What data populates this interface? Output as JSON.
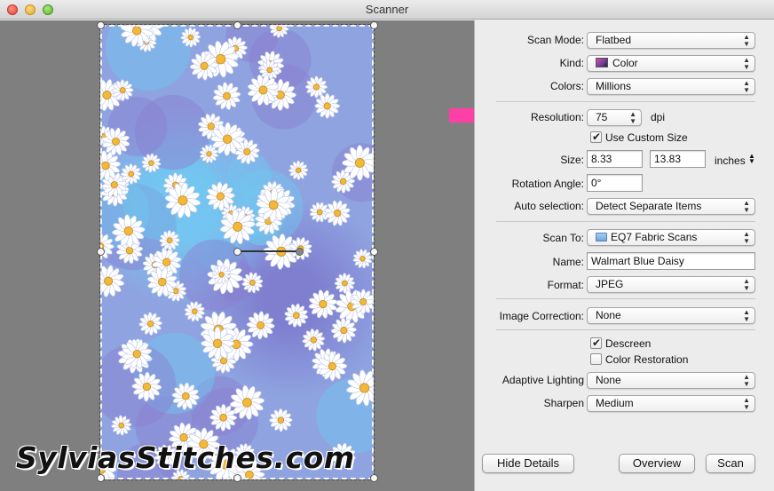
{
  "window": {
    "title": "Scanner"
  },
  "watermark": "SylviasStitches.com",
  "settings": {
    "scan_mode": {
      "label": "Scan Mode:",
      "value": "Flatbed"
    },
    "kind": {
      "label": "Kind:",
      "value": "Color"
    },
    "colors": {
      "label": "Colors:",
      "value": "Millions"
    },
    "resolution": {
      "label": "Resolution:",
      "value": "75",
      "unit": "dpi"
    },
    "use_custom_size": {
      "label": "Use Custom Size",
      "checked": true
    },
    "size": {
      "label": "Size:",
      "width": "8.33",
      "height": "13.83",
      "unit": "inches"
    },
    "rotation_angle": {
      "label": "Rotation Angle:",
      "value": "0°"
    },
    "auto_selection": {
      "label": "Auto selection:",
      "value": "Detect Separate Items"
    },
    "scan_to": {
      "label": "Scan To:",
      "value": "EQ7 Fabric Scans"
    },
    "name": {
      "label": "Name:",
      "value": "Walmart Blue Daisy"
    },
    "format": {
      "label": "Format:",
      "value": "JPEG"
    },
    "image_correction": {
      "label": "Image Correction:",
      "value": "None"
    },
    "descreen": {
      "label": "Descreen",
      "checked": true
    },
    "color_restoration": {
      "label": "Color Restoration",
      "checked": false
    },
    "adaptive_lighting": {
      "label": "Adaptive Lighting",
      "value": "None"
    },
    "sharpen": {
      "label": "Sharpen",
      "value": "Medium"
    }
  },
  "buttons": {
    "hide_details": "Hide Details",
    "overview": "Overview",
    "scan": "Scan"
  },
  "icons": {
    "stepper": "up-down-arrows-icon",
    "pointer": "pink-arrow-icon"
  },
  "colors": {
    "annotation_arrow": "#ff3fa8",
    "preview_background": "#7f7f7f",
    "panel_background": "#ececec"
  }
}
